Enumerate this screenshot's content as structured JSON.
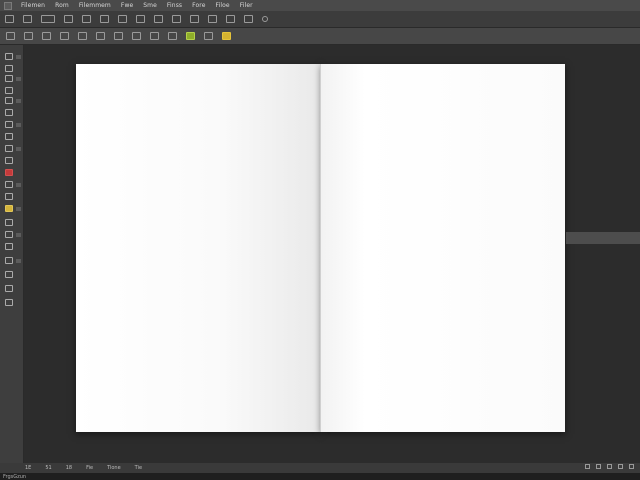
{
  "menubar": {
    "items": [
      "Filemen",
      "Rom",
      "Filemmem",
      "Fwe",
      "Sme",
      "Finss",
      "Fore",
      "Filoe",
      "Filer"
    ]
  },
  "statusbar": {
    "items": [
      "1E",
      "51",
      "18",
      "Fie",
      "Tione",
      "Tie"
    ]
  },
  "taskbar": {
    "label": "FrgsGzun"
  },
  "colors": {
    "accent_green": "#8fae2a",
    "accent_yellow": "#d5b230",
    "accent_red": "#c43a3a"
  }
}
